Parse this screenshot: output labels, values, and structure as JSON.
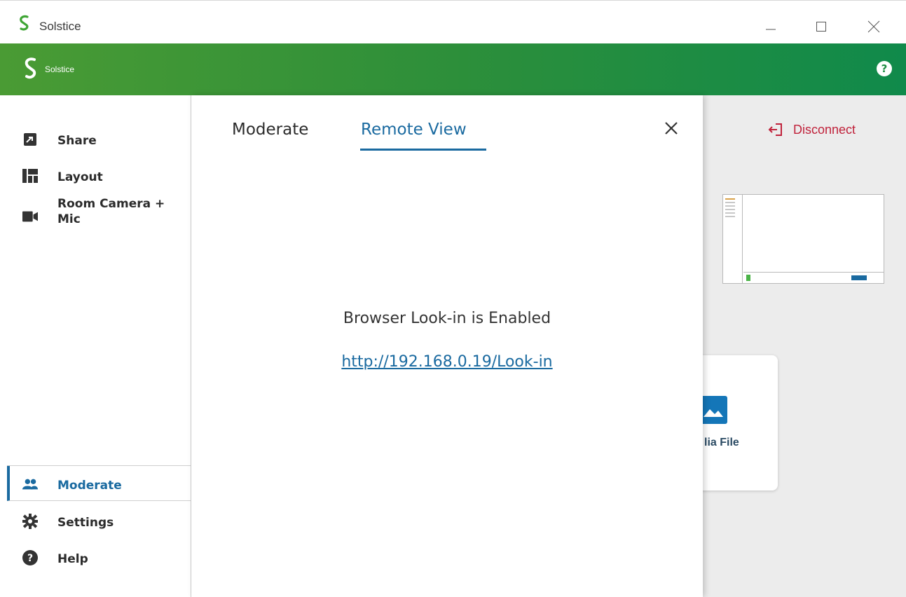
{
  "window": {
    "title": "Solstice",
    "controls": {
      "minimize": "minimize",
      "maximize": "maximize",
      "close": "close"
    }
  },
  "header": {
    "app_name": "Solstice",
    "help_label": "?",
    "colors": {
      "gradient_start": "#4a9b34",
      "gradient_end": "#108a4b"
    }
  },
  "sidebar": {
    "items": [
      {
        "label": "Share",
        "icon": "share-icon"
      },
      {
        "label": "Layout",
        "icon": "layout-icon"
      },
      {
        "label": "Room Camera + Mic",
        "icon": "camera-icon"
      }
    ],
    "bottom_items": [
      {
        "label": "Moderate",
        "icon": "moderate-icon",
        "active": true
      },
      {
        "label": "Settings",
        "icon": "gear-icon"
      },
      {
        "label": "Help",
        "icon": "help-icon"
      }
    ]
  },
  "modal": {
    "tabs": [
      {
        "label": "Moderate",
        "active": false
      },
      {
        "label": "Remote View",
        "active": true
      }
    ],
    "status_text": "Browser Look-in is Enabled",
    "link_text": "http://192.168.0.19/Look-in"
  },
  "background": {
    "disconnect_label": "Disconnect",
    "media_card_label": "lia File"
  },
  "colors": {
    "accent": "#1a6aa0",
    "disconnect": "#c0223b"
  }
}
